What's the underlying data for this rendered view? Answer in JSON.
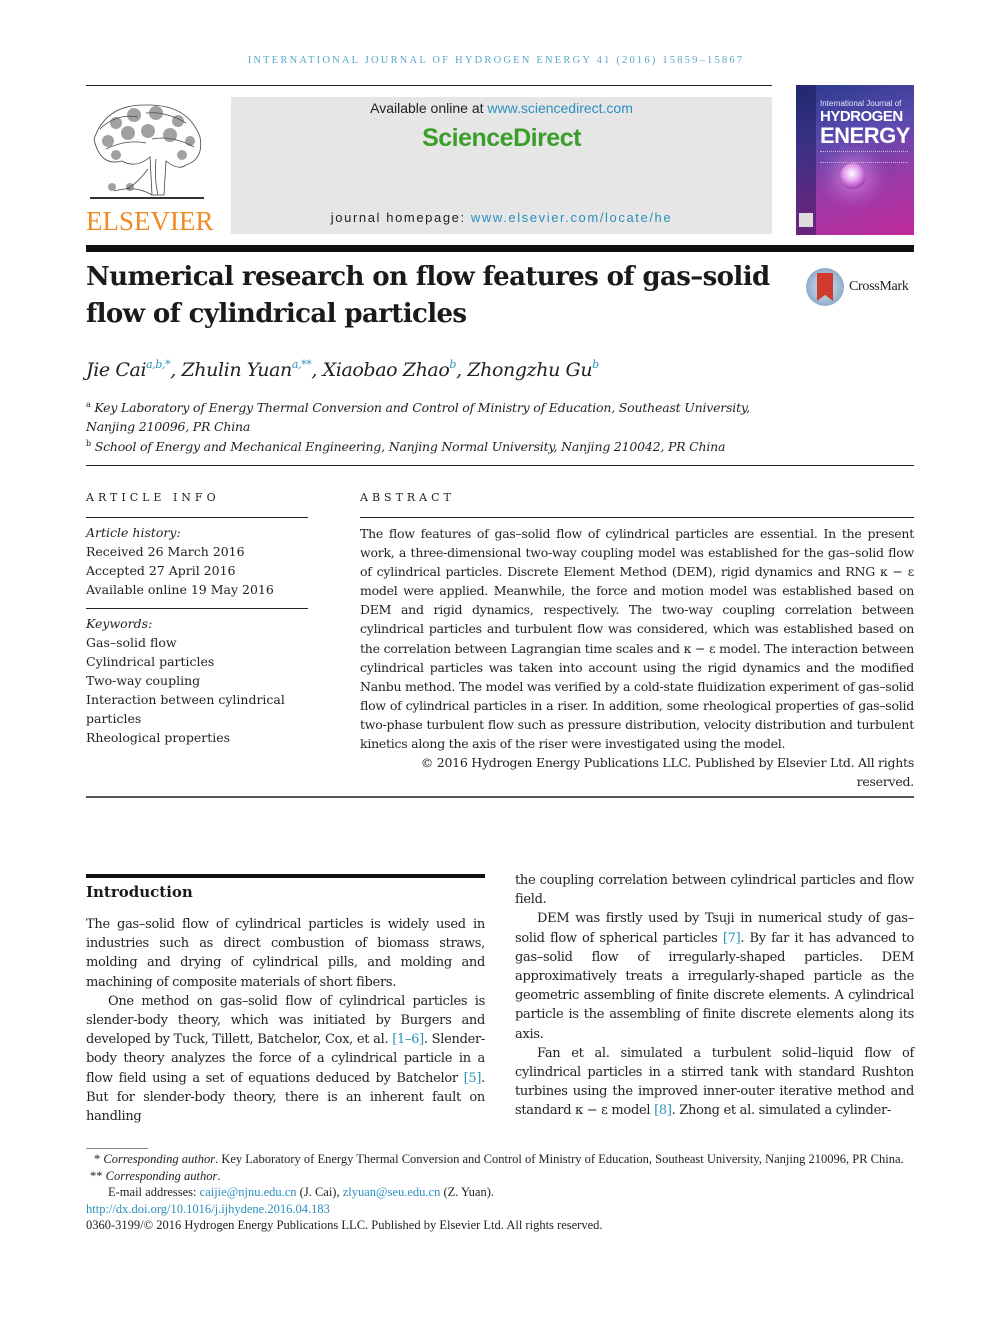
{
  "running_header": "INTERNATIONAL JOURNAL OF HYDROGEN ENERGY 41 (2016) 15859–15867",
  "masthead": {
    "publisher_logo": "ELSEVIER",
    "available_online_prefix": "Available online at ",
    "available_online_link": "www.sciencedirect.com",
    "platform_name": "ScienceDirect",
    "homepage_prefix": "journal homepage: ",
    "homepage_link": "www.elsevier.com/locate/he",
    "cover": {
      "line1": "International Journal of",
      "line2": "HYDROGEN",
      "line3": "ENERGY"
    },
    "colors": {
      "elsevier_orange": "#f08a24",
      "sciencedirect_green": "#3b9e2a",
      "link_blue": "#2a8fbf"
    }
  },
  "article": {
    "title": "Numerical research on flow features of gas–solid flow of cylindrical particles",
    "crossmark_label": "CrossMark",
    "authors": [
      {
        "name": "Jie Cai",
        "sup": "a,b,*"
      },
      {
        "name": "Zhulin Yuan",
        "sup": "a,**"
      },
      {
        "name": "Xiaobao Zhao",
        "sup": "b"
      },
      {
        "name": "Zhongzhu Gu",
        "sup": "b"
      }
    ],
    "affiliations": [
      {
        "mark": "a",
        "text": "Key Laboratory of Energy Thermal Conversion and Control of Ministry of Education, Southeast University, Nanjing 210096, PR China"
      },
      {
        "mark": "b",
        "text": "School of Energy and Mechanical Engineering, Nanjing Normal University, Nanjing 210042, PR China"
      }
    ]
  },
  "article_info": {
    "heading": "ARTICLE INFO",
    "history_label": "Article history:",
    "history": [
      "Received 26 March 2016",
      "Accepted 27 April 2016",
      "Available online 19 May 2016"
    ],
    "keywords_label": "Keywords:",
    "keywords": [
      "Gas–solid flow",
      "Cylindrical particles",
      "Two-way coupling",
      "Interaction between cylindrical particles",
      "Rheological properties"
    ]
  },
  "abstract": {
    "heading": "ABSTRACT",
    "text": "The flow features of gas–solid flow of cylindrical particles are essential. In the present work, a three-dimensional two-way coupling model was established for the gas–solid flow of cylindrical particles. Discrete Element Method (DEM), rigid dynamics and RNG κ − ε model were applied. Meanwhile, the force and motion model was established based on DEM and rigid dynamics, respectively. The two-way coupling correlation between cylindrical particles and turbulent flow was considered, which was established based on the correlation between Lagrangian time scales and κ − ε model. The interaction between cylindrical particles was taken into account using the rigid dynamics and the modified Nanbu method. The model was verified by a cold-state fluidization experiment of gas–solid flow of cylindrical particles in a riser. In addition, some rheological properties of gas–solid two-phase turbulent flow such as pressure distribution, velocity distribution and turbulent kinetics along the axis of the riser were investigated using the model.",
    "copyright": "© 2016 Hydrogen Energy Publications LLC. Published by Elsevier Ltd. All rights reserved."
  },
  "introduction": {
    "heading": "Introduction",
    "left_paragraphs": [
      {
        "segments": [
          {
            "t": "The gas–solid flow of cylindrical particles is widely used in industries such as direct combustion of biomass straws, molding and drying of cylindrical pills, and molding and machining of composite materials of short fibers."
          }
        ]
      },
      {
        "segments": [
          {
            "t": "One method on gas–solid flow of cylindrical particles is slender-body theory, which was initiated by Burgers and developed by Tuck, Tillett, Batchelor, Cox, et al. "
          },
          {
            "t": "[1–6]",
            "ref": true
          },
          {
            "t": ". Slender-body theory analyzes the force of a cylindrical particle in a flow field using a set of equations deduced by Batchelor "
          },
          {
            "t": "[5]",
            "ref": true
          },
          {
            "t": ". But for slender-body theory, there is an inherent fault on handling"
          }
        ]
      }
    ],
    "right_paragraphs": [
      {
        "segments": [
          {
            "t": "the coupling correlation between cylindrical particles and flow field."
          }
        ]
      },
      {
        "segments": [
          {
            "t": "DEM was firstly used by Tsuji in numerical study of gas–solid flow of spherical particles "
          },
          {
            "t": "[7]",
            "ref": true
          },
          {
            "t": ". By far it has advanced to gas–solid flow of irregularly-shaped particles. DEM approximatively treats a irregularly-shaped particle as the geometric assembling of finite discrete elements. A cylindrical particle is the assembling of finite discrete elements along its axis."
          }
        ]
      },
      {
        "segments": [
          {
            "t": "Fan et al. simulated a turbulent solid–liquid flow of cylindrical particles in a stirred tank with standard Rushton turbines using the improved inner-outer iterative method and standard κ − ε model "
          },
          {
            "t": "[8]",
            "ref": true
          },
          {
            "t": ". Zhong et al. simulated a cylinder-"
          }
        ]
      }
    ]
  },
  "footnotes": {
    "corresponding1_mark": "*",
    "corresponding1_label": "Corresponding author",
    "corresponding1_text": ". Key Laboratory of Energy Thermal Conversion and Control of Ministry of Education, Southeast University, Nanjing 210096, PR China.",
    "corresponding2_mark": "**",
    "corresponding2_label": "Corresponding author",
    "corresponding2_text": ".",
    "email_prefix": "E-mail addresses: ",
    "email1": "caijie@njnu.edu.cn",
    "email1_owner": " (J. Cai), ",
    "email2": "zlyuan@seu.edu.cn",
    "email2_owner": " (Z. Yuan).",
    "doi": "http://dx.doi.org/10.1016/j.ijhydene.2016.04.183",
    "issn_copyright": "0360-3199/© 2016 Hydrogen Energy Publications LLC. Published by Elsevier Ltd. All rights reserved."
  }
}
